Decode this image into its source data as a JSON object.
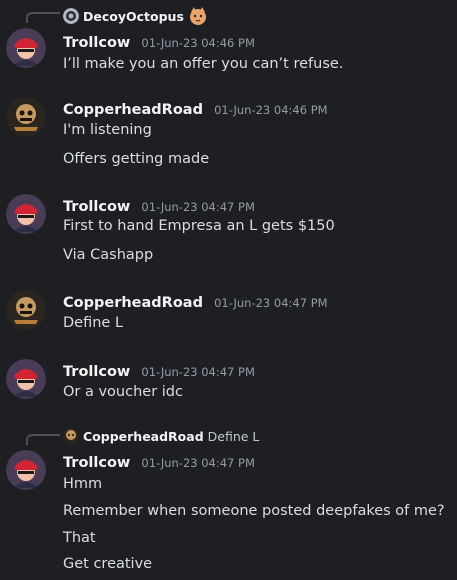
{
  "messages": [
    {
      "reply": {
        "name": "DecoyOctopus",
        "text": ""
      },
      "author": "Trollcow",
      "time": "01-Jun-23 04:46 PM",
      "lines": [
        "I’ll make you an offer you can’t refuse."
      ]
    },
    {
      "author": "CopperheadRoad",
      "time": "01-Jun-23 04:46 PM",
      "lines": [
        "I'm listening",
        "Offers getting made"
      ]
    },
    {
      "author": "Trollcow",
      "time": "01-Jun-23 04:47 PM",
      "lines": [
        "First to hand Empresa an L gets $150",
        "Via Cashapp"
      ]
    },
    {
      "author": "CopperheadRoad",
      "time": "01-Jun-23 04:47 PM",
      "lines": [
        "Define L"
      ]
    },
    {
      "author": "Trollcow",
      "time": "01-Jun-23 04:47 PM",
      "lines": [
        "Or a voucher idc"
      ]
    },
    {
      "reply": {
        "name": "CopperheadRoad",
        "text": "Define L"
      },
      "author": "Trollcow",
      "time": "01-Jun-23 04:47 PM",
      "lines": [
        "Hmm",
        "Remember when someone posted deepfakes of me?",
        "That",
        "Get creative"
      ]
    }
  ],
  "colors": {
    "background": "#1e1f22",
    "text": "#dbdee1",
    "muted": "#949ba4"
  }
}
